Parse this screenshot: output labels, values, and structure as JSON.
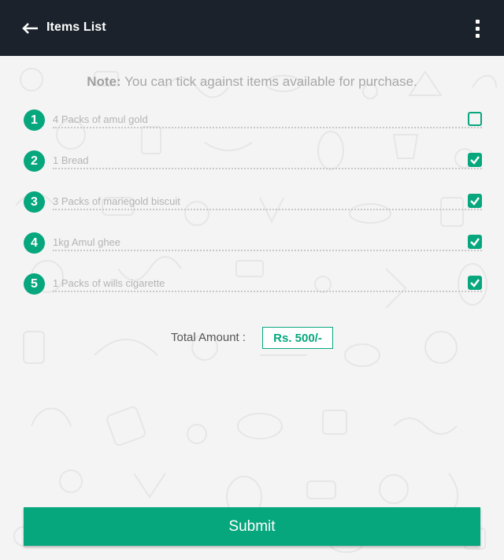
{
  "appbar": {
    "title": "Items List",
    "back_icon": "arrow-left-icon",
    "menu_icon": "more-vertical-icon",
    "background": "#1b222b"
  },
  "note": {
    "prefix": "Note:",
    "text": " You can tick against items available for purchase."
  },
  "items": [
    {
      "number": "1",
      "label": "4 Packs of amul gold",
      "checked": false
    },
    {
      "number": "2",
      "label": "1 Bread",
      "checked": true
    },
    {
      "number": "3",
      "label": "3 Packs of mariegold biscuit",
      "checked": true
    },
    {
      "number": "4",
      "label": "1kg Amul ghee",
      "checked": true
    },
    {
      "number": "5",
      "label": "1 Packs of wills cigarette",
      "checked": true
    }
  ],
  "total": {
    "label": "Total Amount :",
    "value": "Rs. 500/-"
  },
  "submit": {
    "label": "Submit"
  },
  "colors": {
    "accent": "#07a77e",
    "background": "#f4f4f4"
  }
}
